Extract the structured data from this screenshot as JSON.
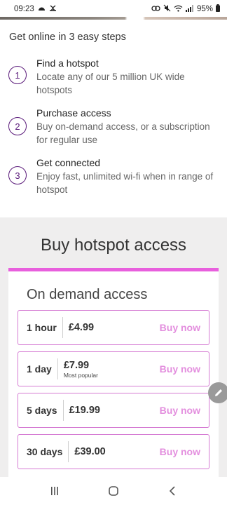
{
  "status_bar": {
    "time": "09:23",
    "battery": "95%"
  },
  "steps": {
    "title": "Get online in 3 easy steps",
    "items": [
      {
        "number": "1",
        "title": "Find a hotspot",
        "desc": "Locate any of our 5 million UK wide hotspots"
      },
      {
        "number": "2",
        "title": "Purchase access",
        "desc": "Buy on-demand access, or a subscription for regular use"
      },
      {
        "number": "3",
        "title": "Get connected",
        "desc": "Enjoy fast, unlimited wi-fi when in range of hotspot"
      }
    ]
  },
  "buy": {
    "title": "Buy hotspot access",
    "card_title": "On demand access",
    "options": [
      {
        "duration": "1 hour",
        "price": "£4.99",
        "sub": "",
        "action": "Buy now"
      },
      {
        "duration": "1 day",
        "price": "£7.99",
        "sub": "Most popular",
        "action": "Buy now"
      },
      {
        "duration": "5 days",
        "price": "£19.99",
        "sub": "",
        "action": "Buy now"
      },
      {
        "duration": "30 days",
        "price": "£39.00",
        "sub": "",
        "action": "Buy now"
      }
    ]
  },
  "colors": {
    "accent_purple": "#5a1a7a",
    "accent_pink": "#e85fdd",
    "buy_now_text": "#e38ede"
  }
}
